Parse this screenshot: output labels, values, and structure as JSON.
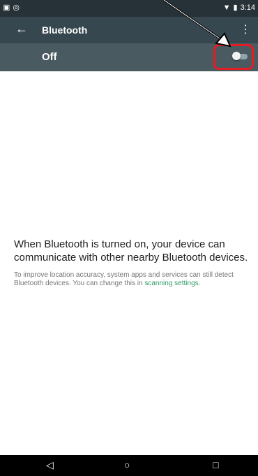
{
  "status_bar": {
    "left_icons": [
      "image-icon",
      "sync-icon"
    ],
    "right_icons": [
      "wifi-icon",
      "battery-icon"
    ],
    "time": "3:14"
  },
  "app_bar": {
    "title": "Bluetooth",
    "back_icon": "arrow-back-icon",
    "menu_icon": "overflow-menu-icon"
  },
  "toggle": {
    "label": "Off",
    "state": "off"
  },
  "content": {
    "main_text": "When Bluetooth is turned on, your device can communicate with other nearby Bluetooth devices.",
    "sub_text_prefix": "To improve location accuracy, system apps and services can still detect Bluetooth devices. You can change this in ",
    "sub_link": "scanning settings",
    "sub_text_suffix": "."
  },
  "nav_bar": {
    "back_label": "◁",
    "home_label": "○",
    "recents_label": "□"
  },
  "colors": {
    "status_bar": "#263238",
    "app_bar": "#37474f",
    "toggle_bar": "#4a5a61",
    "link": "#2e9b66",
    "highlight": "#e51c23"
  }
}
